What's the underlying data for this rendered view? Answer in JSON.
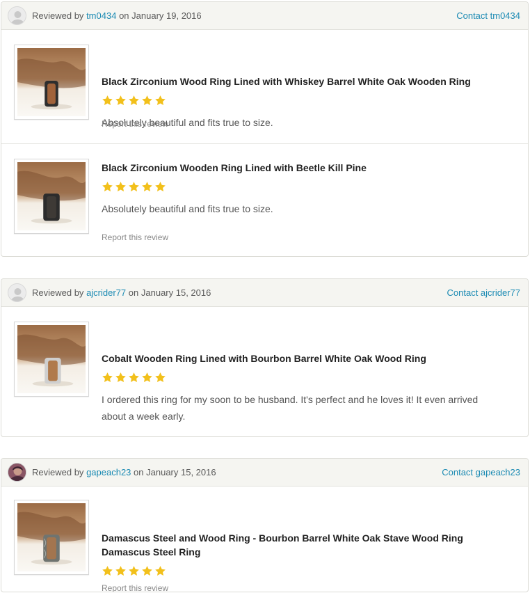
{
  "labels": {
    "reviewed_by": "Reviewed by",
    "on": "on",
    "report": "Report this review"
  },
  "colors": {
    "link": "#1a8ab3",
    "star": "#f2c01b",
    "header_bg": "#f5f5f1"
  },
  "groups": [
    {
      "reviewer": "tm0434",
      "date": "January 19, 2016",
      "contact": "Contact tm0434",
      "avatar": "default-avatar-icon",
      "reviews": [
        {
          "title": "Black Zirconium Wood Ring Lined with Whiskey Barrel White Oak Wooden Ring",
          "rating": 5,
          "text": "Absolutely beautiful and fits true to size."
        },
        {
          "title": "Black Zirconium Wooden Ring Lined with Beetle Kill Pine",
          "rating": 5,
          "text": "Absolutely beautiful and fits true to size."
        }
      ]
    },
    {
      "reviewer": "ajcrider77",
      "date": "January 15, 2016",
      "contact": "Contact ajcrider77",
      "avatar": "default-avatar-icon",
      "reviews": [
        {
          "title": "Cobalt Wooden Ring Lined with Bourbon Barrel White Oak Wood Ring",
          "rating": 5,
          "text": "I ordered this ring for my soon to be husband. It's perfect and he loves it! It even arrived about a week early."
        }
      ]
    },
    {
      "reviewer": "gapeach23",
      "date": "January 15, 2016",
      "contact": "Contact gapeach23",
      "avatar": "user-photo-avatar",
      "reviews": [
        {
          "title": "Damascus Steel and Wood Ring - Bourbon Barrel White Oak Stave Wood Ring Damascus Steel Ring",
          "rating": 5,
          "text": ""
        }
      ]
    }
  ]
}
